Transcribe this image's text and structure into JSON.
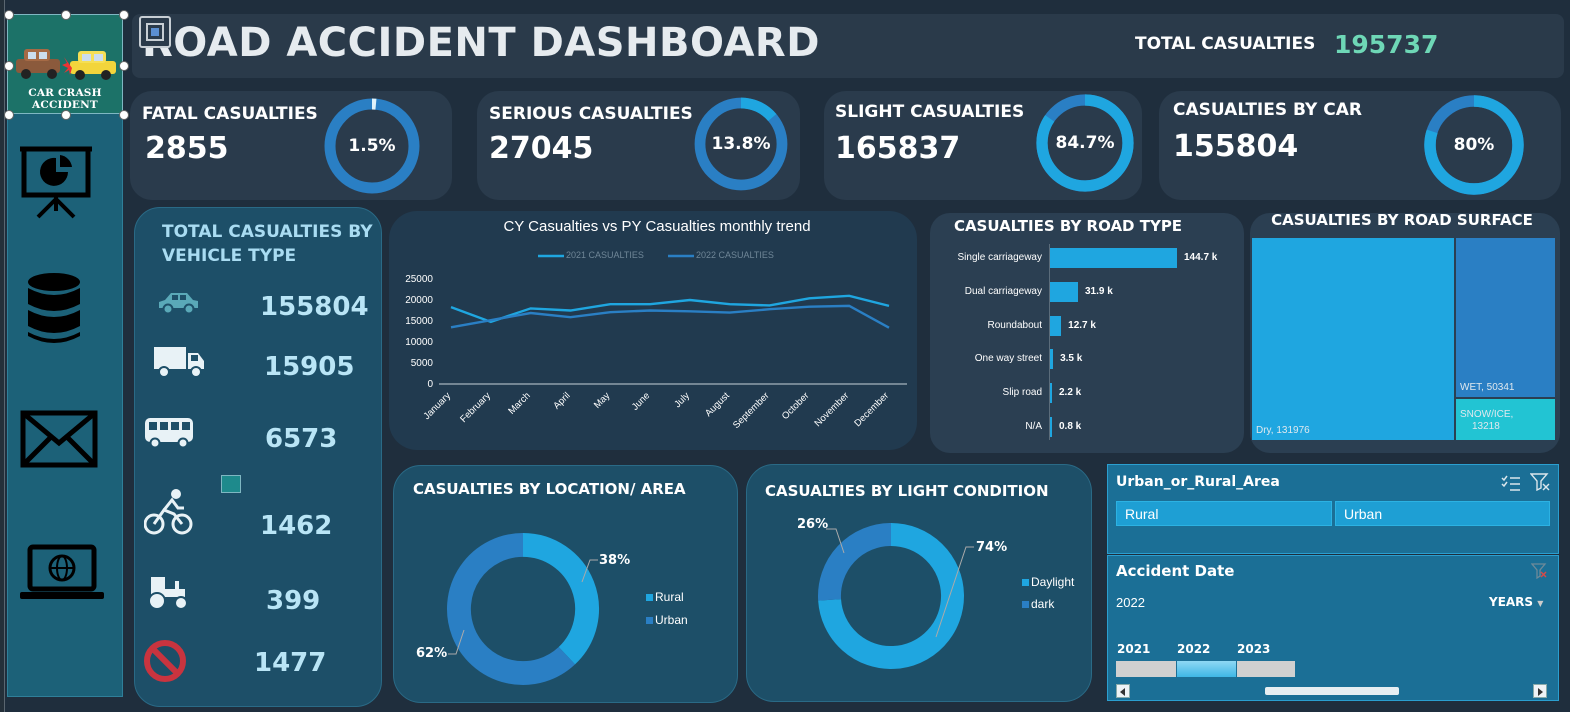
{
  "header": {
    "title": "ROAD ACCIDENT DASHBOARD",
    "total_label": "TOTAL CASUALTIES",
    "total_value": "195737"
  },
  "logo": {
    "text": "CAR CRASH ACCIDENT"
  },
  "sidebar": {
    "items": [
      {
        "icon": "presentation-chart-icon"
      },
      {
        "icon": "database-icon"
      },
      {
        "icon": "mail-icon"
      },
      {
        "icon": "laptop-globe-icon"
      }
    ]
  },
  "kpis": [
    {
      "title": "FATAL CASUALTIES",
      "value": "2855",
      "pct_label": "1.5%",
      "pct": 1.5
    },
    {
      "title": "SERIOUS CASUALTIES",
      "value": "27045",
      "pct_label": "13.8%",
      "pct": 13.8
    },
    {
      "title": "SLIGHT CASUALTIES",
      "value": "165837",
      "pct_label": "84.7%",
      "pct": 84.7
    },
    {
      "title": "CASUALTIES BY CAR",
      "value": "155804",
      "pct_label": "80%",
      "pct": 80
    }
  ],
  "vehicle": {
    "title_line1": "TOTAL CASUALTIES BY",
    "title_line2": "VEHICLE TYPE",
    "items": [
      {
        "icon": "car-icon",
        "value": "155804"
      },
      {
        "icon": "truck-icon",
        "value": "15905"
      },
      {
        "icon": "bus-icon",
        "value": "6573"
      },
      {
        "icon": "bicycle-icon",
        "value": "1462"
      },
      {
        "icon": "tractor-icon",
        "value": "399"
      },
      {
        "icon": "prohibited-icon",
        "value": "1477"
      }
    ]
  },
  "colors": {
    "cy": "#1fa6e0",
    "py": "#2a7fc4",
    "dark_bg": "#1f2e3d",
    "panel": "#2a3b4c"
  },
  "trend_chart": {
    "title": "CY Casualties vs PY Casualties monthly trend",
    "legend": [
      "2021 CASUALTIES",
      "2022 CASUALTIES"
    ]
  },
  "road_type": {
    "title": "CASUALTIES BY ROAD TYPE"
  },
  "road_surface": {
    "title": "CASUALTIES BY ROAD SURFACE",
    "labels": {
      "dry": "Dry, 131976",
      "wet": "WET, 50341",
      "snow_line1": "SNOW/ICE,",
      "snow_line2": "13218"
    }
  },
  "location": {
    "title": "CASUALTIES BY LOCATION/ AREA",
    "legend": [
      "Rural",
      "Urban"
    ],
    "labels": [
      "38%",
      "62%"
    ]
  },
  "light": {
    "title": "CASUALTIES BY LIGHT CONDITION",
    "legend": [
      "Daylight",
      "dark"
    ],
    "labels": [
      "74%",
      "26%"
    ]
  },
  "slicer": {
    "title": "Urban_or_Rural_Area",
    "options": [
      "Rural",
      "Urban"
    ],
    "date_title": "Accident Date",
    "selected": "2022",
    "period": "YEARS",
    "years": [
      "2021",
      "2022",
      "2023"
    ]
  },
  "chart_data": [
    {
      "type": "line",
      "title": "CY Casualties vs PY Casualties monthly trend",
      "categories": [
        "January",
        "February",
        "March",
        "April",
        "May",
        "June",
        "July",
        "August",
        "September",
        "October",
        "November",
        "December"
      ],
      "series": [
        {
          "name": "2021 CASUALTIES",
          "values": [
            18300,
            14800,
            18000,
            17500,
            19000,
            19000,
            20000,
            19000,
            18700,
            20400,
            21000,
            18600
          ]
        },
        {
          "name": "2022 CASUALTIES",
          "values": [
            13500,
            15200,
            16900,
            15900,
            17100,
            17500,
            17300,
            17000,
            17800,
            18400,
            18600,
            13400
          ]
        }
      ],
      "yticks": [
        0,
        5000,
        10000,
        15000,
        20000,
        25000
      ],
      "ylim": [
        0,
        25000
      ]
    },
    {
      "type": "bar",
      "title": "CASUALTIES BY ROAD TYPE",
      "categories": [
        "Single carriageway",
        "Dual carriageway",
        "Roundabout",
        "One way street",
        "Slip road",
        "N/A"
      ],
      "values": [
        144.7,
        31.9,
        12.7,
        3.5,
        2.2,
        0.8
      ],
      "data_labels": [
        "144.7 k",
        "31.9 k",
        "12.7 k",
        "3.5 k",
        "2.2 k",
        "0.8 k"
      ]
    },
    {
      "type": "pie",
      "title": "CASUALTIES BY LOCATION/ AREA",
      "categories": [
        "Rural",
        "Urban"
      ],
      "values": [
        38,
        62
      ]
    },
    {
      "type": "pie",
      "title": "CASUALTIES BY LIGHT CONDITION",
      "categories": [
        "Daylight",
        "dark"
      ],
      "values": [
        74,
        26
      ]
    },
    {
      "type": "heatmap",
      "title": "CASUALTIES BY ROAD SURFACE",
      "categories": [
        "Dry",
        "WET",
        "SNOW/ICE"
      ],
      "values": [
        131976,
        50341,
        13218
      ]
    }
  ]
}
